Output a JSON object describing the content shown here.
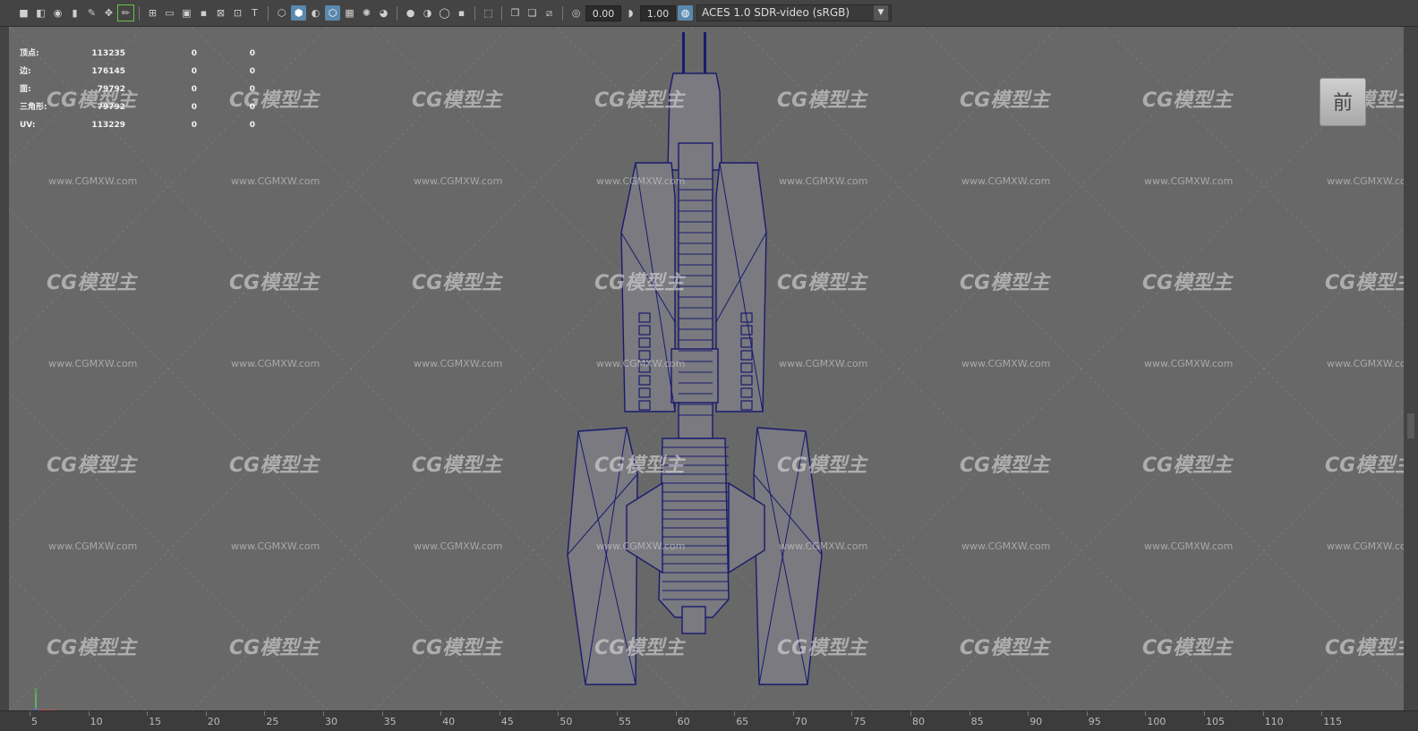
{
  "toolbar": {
    "exposure_value": "0.00",
    "gamma_value": "1.00",
    "color_space": "ACES 1.0 SDR-video (sRGB)"
  },
  "hud": {
    "rows": [
      {
        "label": "顶点:",
        "v1": "113235",
        "v2": "0",
        "v3": "0"
      },
      {
        "label": "边:",
        "v1": "176145",
        "v2": "0",
        "v3": "0"
      },
      {
        "label": "面:",
        "v1": "79792",
        "v2": "0",
        "v3": "0"
      },
      {
        "label": "三角形:",
        "v1": "79792",
        "v2": "0",
        "v3": "0"
      },
      {
        "label": "UV:",
        "v1": "113229",
        "v2": "0",
        "v3": "0"
      }
    ]
  },
  "viewport": {
    "camera": "persp",
    "viewcube_face": "前",
    "watermark_logo": "CG模型主",
    "watermark_url": "www.CGMXW.com",
    "wireframe_color": "#1a1a6e",
    "background_color": "#686868"
  },
  "timeline": {
    "ticks": [
      "5",
      "10",
      "15",
      "20",
      "25",
      "30",
      "35",
      "40",
      "45",
      "50",
      "55",
      "60",
      "65",
      "70",
      "75",
      "80",
      "85",
      "90",
      "95",
      "100",
      "105",
      "110",
      "115"
    ]
  }
}
